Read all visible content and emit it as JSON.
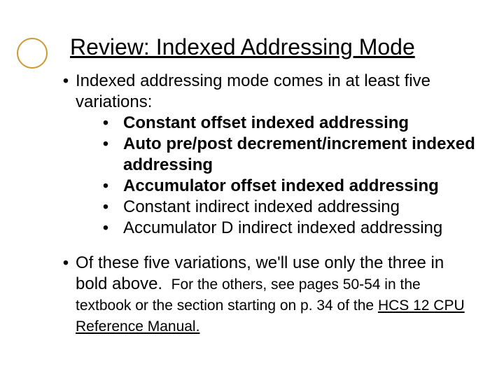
{
  "title": "Review: Indexed Addressing Mode",
  "intro": "Indexed addressing mode comes in at least five variations:",
  "variations": {
    "v1": "Constant offset indexed addressing",
    "v2": "Auto pre/post decrement/increment indexed addressing",
    "v3": "Accumulator offset indexed addressing",
    "v4": "Constant indirect indexed addressing",
    "v5": "Accumulator D indirect indexed addressing"
  },
  "outro1": "Of these five variations, we'll use only the three in bold above.",
  "outro2a": "For the others, see pages 50-54 in the textbook or the section starting on p. 34 of the ",
  "outro2b": "HCS 12 CPU Reference Manual.",
  "bullet": "•"
}
